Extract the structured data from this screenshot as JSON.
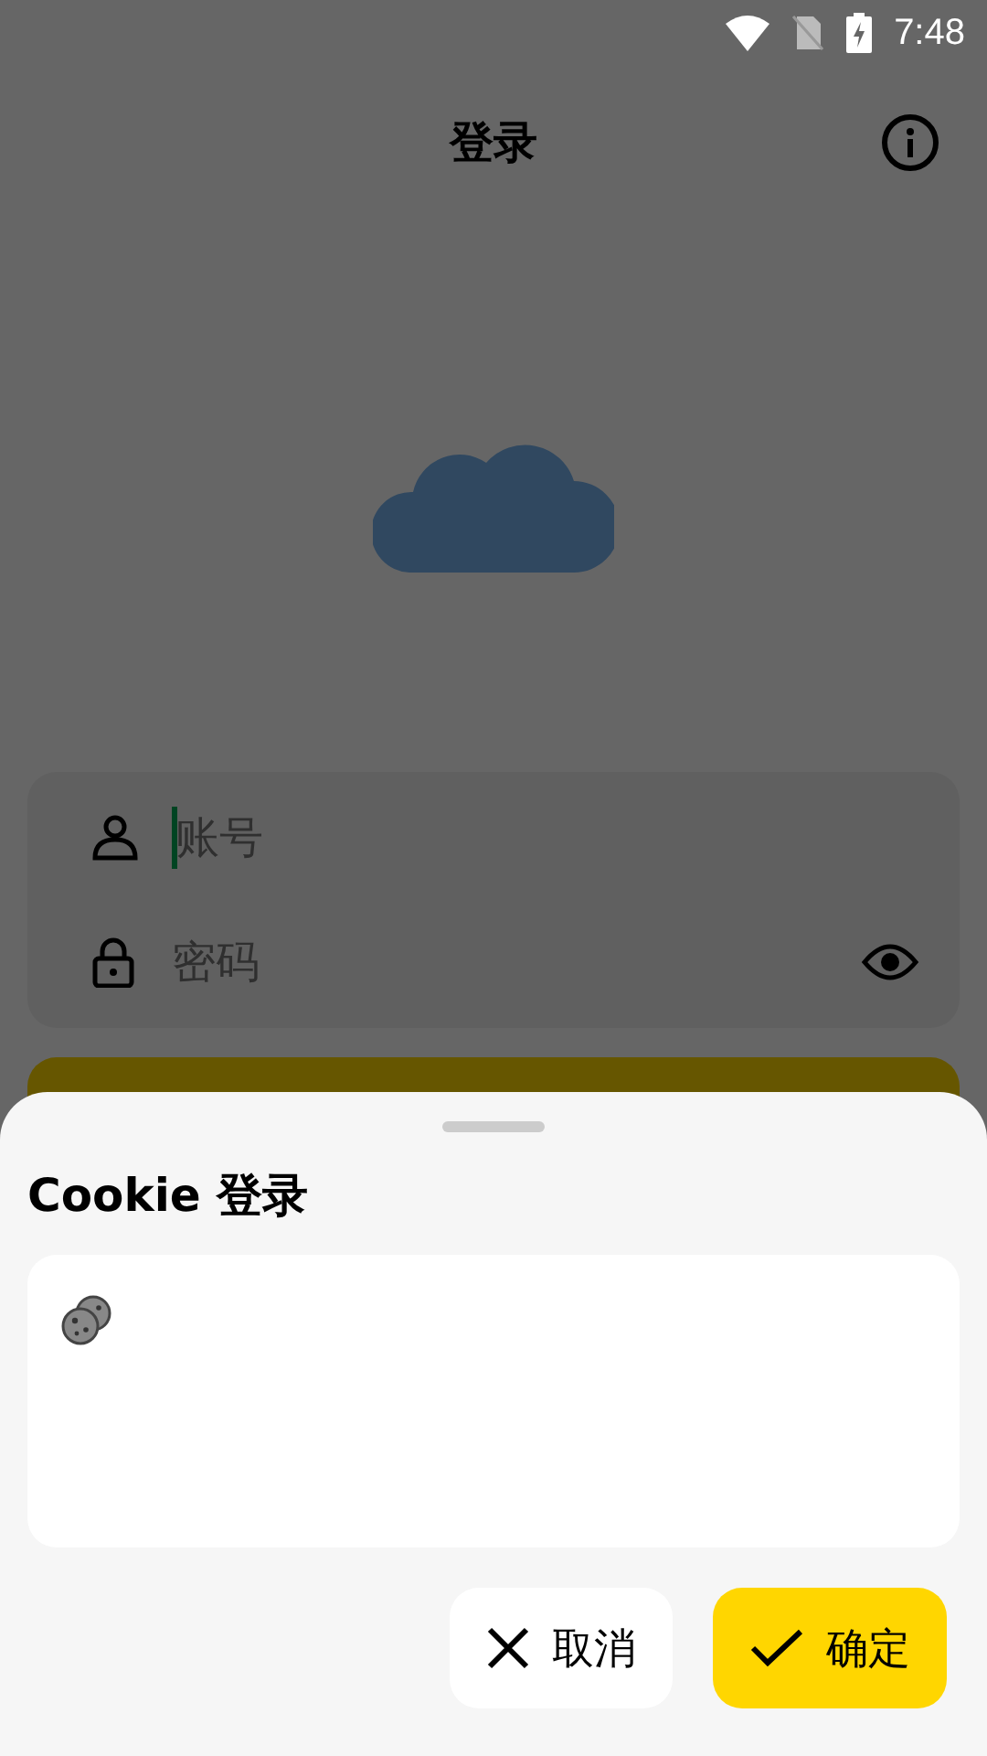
{
  "status_bar": {
    "time": "7:48"
  },
  "app_bar": {
    "title": "登录"
  },
  "login_form": {
    "account": {
      "placeholder": "账号",
      "focused": true
    },
    "password": {
      "placeholder": "密码",
      "focused": false
    }
  },
  "sheet": {
    "title": "Cookie 登录",
    "buttons": [
      {
        "label": "取消",
        "kind": "cancel"
      },
      {
        "label": "确定",
        "kind": "confirm"
      }
    ]
  }
}
